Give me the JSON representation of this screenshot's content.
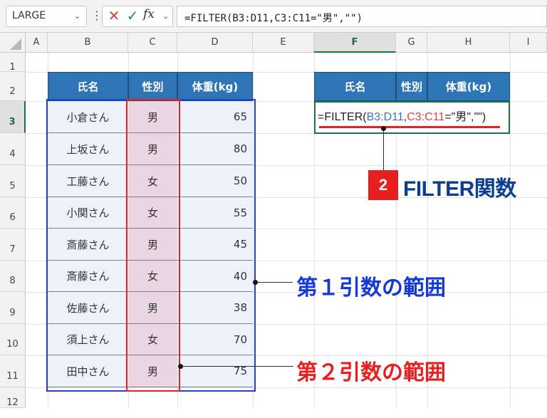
{
  "formula_bar": {
    "name_box": "LARGE",
    "cancel_icon": "close-icon",
    "enter_icon": "checkmark-icon",
    "fx_label": "fx",
    "formula": "=FILTER(B3:D11,C3:C11=\"男\",\"\")"
  },
  "columns": [
    "A",
    "B",
    "C",
    "D",
    "E",
    "F",
    "G",
    "H",
    "I"
  ],
  "rows": [
    "1",
    "2",
    "3",
    "4",
    "5",
    "6",
    "7",
    "8",
    "9",
    "10",
    "11",
    "12"
  ],
  "source_table": {
    "headers": [
      "氏名",
      "性別",
      "体重(kg)"
    ],
    "rows": [
      {
        "name": "小倉さん",
        "gender": "男",
        "weight": "65"
      },
      {
        "name": "上坂さん",
        "gender": "男",
        "weight": "80"
      },
      {
        "name": "工藤さん",
        "gender": "女",
        "weight": "50"
      },
      {
        "name": "小関さん",
        "gender": "女",
        "weight": "55"
      },
      {
        "name": "斎藤さん",
        "gender": "男",
        "weight": "45"
      },
      {
        "name": "斎藤さん",
        "gender": "女",
        "weight": "40"
      },
      {
        "name": "佐藤さん",
        "gender": "男",
        "weight": "38"
      },
      {
        "name": "須上さん",
        "gender": "女",
        "weight": "70"
      },
      {
        "name": "田中さん",
        "gender": "男",
        "weight": "75"
      }
    ]
  },
  "result_table": {
    "headers": [
      "氏名",
      "性別",
      "体重(kg)"
    ],
    "formula_parts": {
      "prefix": "=FILTER(",
      "arg1": "B3:D11",
      "comma1": ",",
      "arg2": "C3:C11",
      "rest": "=\"男\",\"\")"
    }
  },
  "annotations": {
    "badge": "2",
    "filter_label": "FILTER関数",
    "arg1_label": "第１引数の範囲",
    "arg2_label": "第２引数の範囲"
  },
  "colors": {
    "header_fill": "#2e75b6",
    "arg1_range": "#1f3fd8",
    "arg2_range": "#e82020",
    "badge": "#e81f1f",
    "filter_label": "#0b3d91"
  }
}
